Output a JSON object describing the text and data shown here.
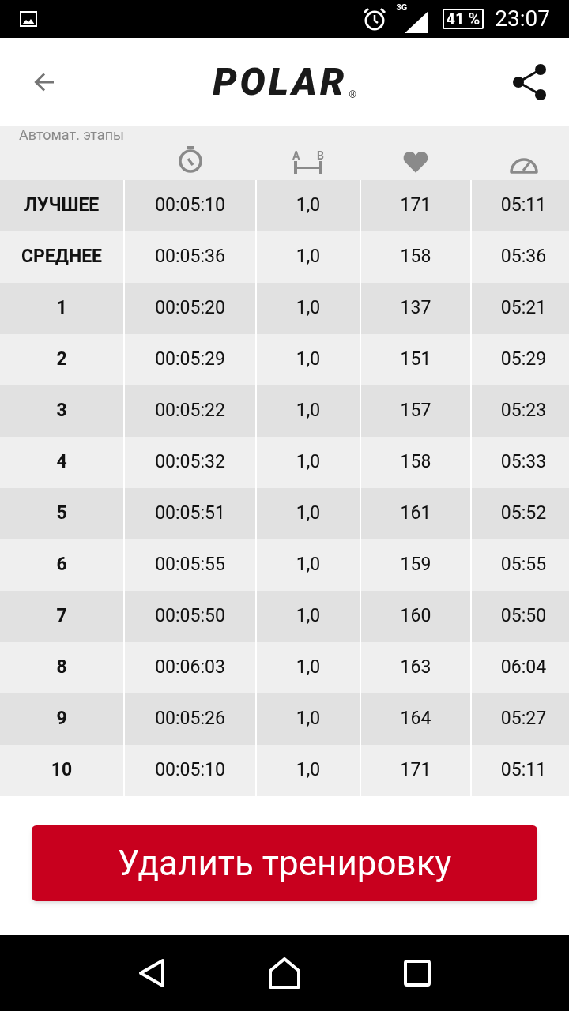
{
  "status_bar": {
    "network": "3G",
    "battery": "41 %",
    "time": "23:07"
  },
  "header": {
    "logo": "POLAR",
    "logo_mark": "®"
  },
  "section_title": "Автомат. этапы",
  "table": {
    "rows": [
      {
        "label": "ЛУЧШЕЕ",
        "time": "00:05:10",
        "distance": "1,0",
        "heart_rate": "171",
        "pace": "05:11"
      },
      {
        "label": "СРЕДНЕЕ",
        "time": "00:05:36",
        "distance": "1,0",
        "heart_rate": "158",
        "pace": "05:36"
      },
      {
        "label": "1",
        "time": "00:05:20",
        "distance": "1,0",
        "heart_rate": "137",
        "pace": "05:21"
      },
      {
        "label": "2",
        "time": "00:05:29",
        "distance": "1,0",
        "heart_rate": "151",
        "pace": "05:29"
      },
      {
        "label": "3",
        "time": "00:05:22",
        "distance": "1,0",
        "heart_rate": "157",
        "pace": "05:23"
      },
      {
        "label": "4",
        "time": "00:05:32",
        "distance": "1,0",
        "heart_rate": "158",
        "pace": "05:33"
      },
      {
        "label": "5",
        "time": "00:05:51",
        "distance": "1,0",
        "heart_rate": "161",
        "pace": "05:52"
      },
      {
        "label": "6",
        "time": "00:05:55",
        "distance": "1,0",
        "heart_rate": "159",
        "pace": "05:55"
      },
      {
        "label": "7",
        "time": "00:05:50",
        "distance": "1,0",
        "heart_rate": "160",
        "pace": "05:50"
      },
      {
        "label": "8",
        "time": "00:06:03",
        "distance": "1,0",
        "heart_rate": "163",
        "pace": "06:04"
      },
      {
        "label": "9",
        "time": "00:05:26",
        "distance": "1,0",
        "heart_rate": "164",
        "pace": "05:27"
      },
      {
        "label": "10",
        "time": "00:05:10",
        "distance": "1,0",
        "heart_rate": "171",
        "pace": "05:11"
      }
    ]
  },
  "distance_icon_labels": [
    "A",
    "B"
  ],
  "delete_button": "Удалить тренировку"
}
